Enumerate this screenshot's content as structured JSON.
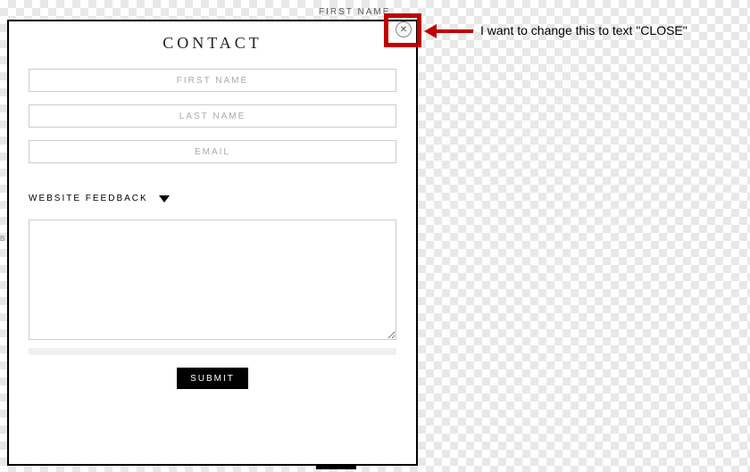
{
  "background": {
    "partial_label": "FIRST NAME"
  },
  "modal": {
    "title": "CONTACT",
    "fields": {
      "first_name_placeholder": "FIRST NAME",
      "last_name_placeholder": "LAST NAME",
      "email_placeholder": "EMAIL"
    },
    "dropdown": {
      "selected": "WEBSITE FEEDBACK"
    },
    "submit_label": "SUBMIT",
    "close_symbol": "✕"
  },
  "annotation": {
    "text": "I want to change this to text \"CLOSE\""
  },
  "side_marker": "B"
}
